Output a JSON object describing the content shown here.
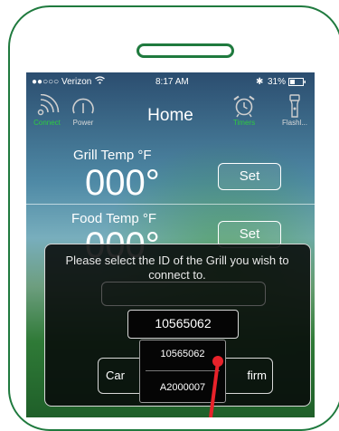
{
  "status_bar": {
    "carrier": "●●○○○ Verizon",
    "time": "8:17 AM",
    "battery": "31%"
  },
  "nav": {
    "title": "Home",
    "buttons": [
      {
        "label": "Connect",
        "icon": "wifi-signal-icon",
        "color": "#2ecc40"
      },
      {
        "label": "Power",
        "icon": "gauge-power-icon",
        "color": "#cccccc"
      },
      {
        "label": "Timers",
        "icon": "alarm-clock-icon",
        "color": "#2ecc40"
      },
      {
        "label": "Flashl...",
        "icon": "flashlight-icon",
        "color": "#cccccc"
      }
    ]
  },
  "grill": {
    "label": "Grill Temp °F",
    "value": "000°",
    "set_label": "Set"
  },
  "food": {
    "label": "Food Temp °F",
    "value": "000°",
    "set_label": "Set"
  },
  "dialog": {
    "message": "Please select the ID of the Grill you wish to connect to.",
    "selected_id": "10565062",
    "cancel_label": "Car",
    "confirm_label": "firm",
    "options": [
      "10565062",
      "A2000007"
    ]
  },
  "colors": {
    "frame": "#1f7a3e",
    "accent_green": "#2ecc40",
    "pointer_red": "#e8222a"
  }
}
